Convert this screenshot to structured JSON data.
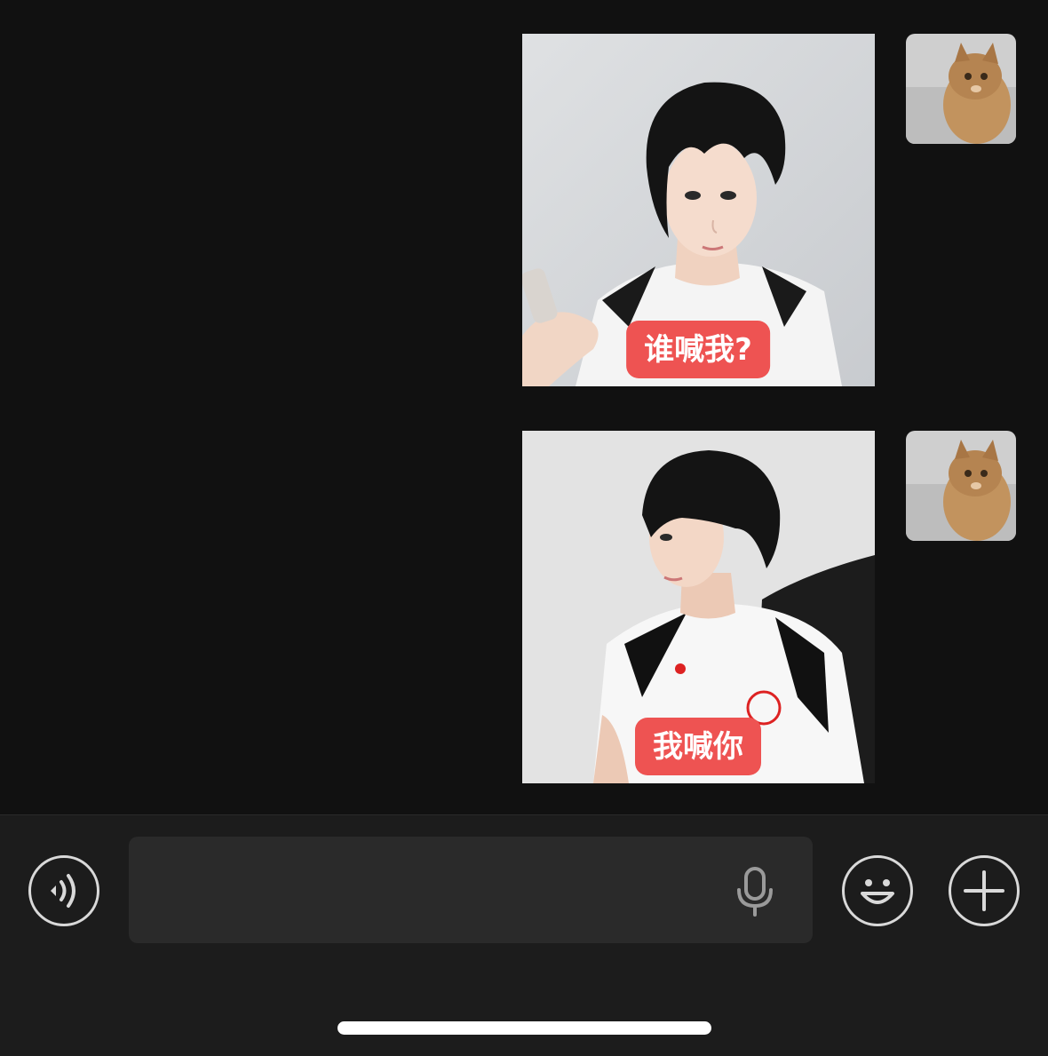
{
  "messages": [
    {
      "type": "sticker",
      "caption": "谁喊我?"
    },
    {
      "type": "sticker",
      "caption": "我喊你"
    }
  ],
  "input_bar": {
    "text_value": "",
    "voice_toggle_icon": "voice-wave-icon",
    "mic_icon": "microphone-icon",
    "emoji_icon": "smiley-icon",
    "more_icon": "plus-icon"
  },
  "colors": {
    "background": "#111111",
    "input_bar": "#1c1c1c",
    "caption_bg": "#ee5352"
  }
}
